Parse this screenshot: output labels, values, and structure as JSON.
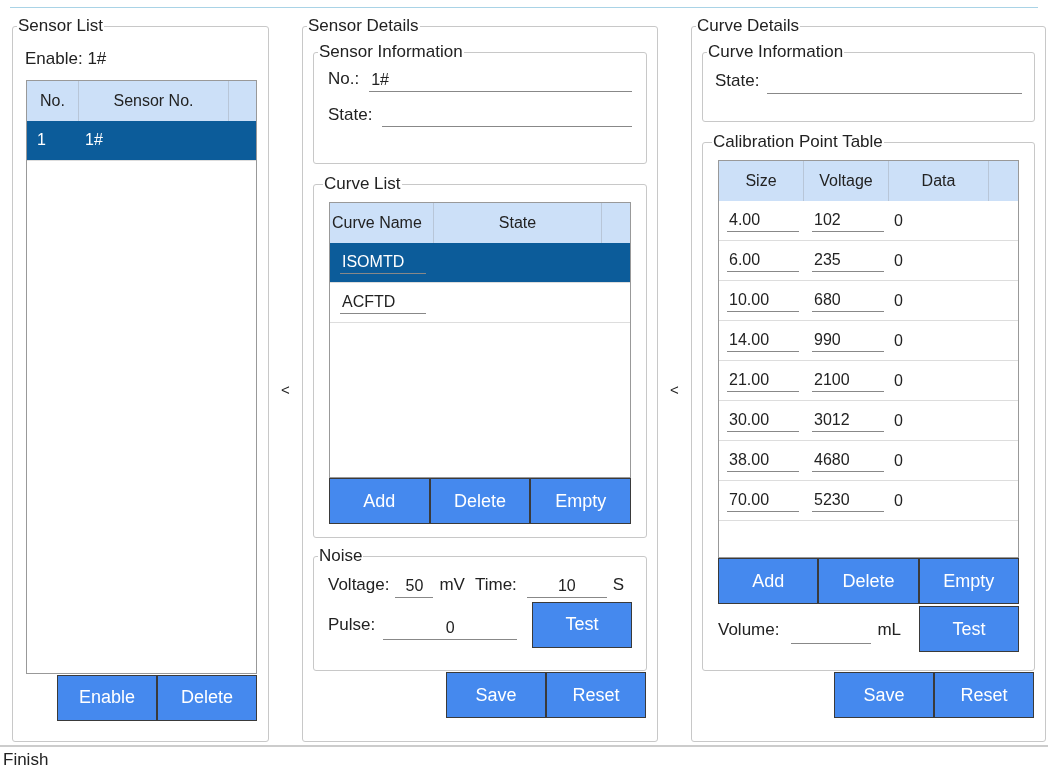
{
  "sensor_list": {
    "title": "Sensor List",
    "enable_label": "Enable: 1#",
    "columns": [
      "No.",
      "Sensor No."
    ],
    "rows": [
      {
        "cells": [
          "1",
          "1#"
        ],
        "selected": true
      }
    ],
    "buttons": [
      "Enable",
      "Delete"
    ]
  },
  "collapse_left": "<",
  "sensor_details": {
    "title": "Sensor Details",
    "sensor_information": {
      "title": "Sensor Information",
      "fields": [
        {
          "label": "No.:",
          "value": "1#"
        },
        {
          "label": "State:"
        }
      ]
    },
    "curve_list": {
      "title": "Curve List",
      "columns": [
        "Curve Name",
        "State"
      ],
      "rows": [
        {
          "name": "ISOMTD",
          "selected": true
        },
        {
          "name": "ACFTD",
          "selected": false
        }
      ],
      "buttons": [
        "Add",
        "Delete",
        "Empty"
      ]
    },
    "noise": {
      "title": "Noise",
      "voltage_label": "Voltage:",
      "voltage": "50",
      "voltage_unit": "mV",
      "time_label": "Time:",
      "time": "10",
      "time_unit": "S",
      "pulse_label": "Pulse:",
      "pulse": "0",
      "test_button": "Test"
    },
    "buttons": [
      "Save",
      "Reset"
    ]
  },
  "collapse_right": "<",
  "curve_details": {
    "title": "Curve Details",
    "curve_information": {
      "title": "Curve Information",
      "state_label": "State:"
    },
    "calibration_point_table": {
      "title": "Calibration Point Table",
      "columns": [
        "Size",
        "Voltage",
        "Data"
      ],
      "rows": [
        {
          "size": "4.00",
          "voltage": "102",
          "data": "0"
        },
        {
          "size": "6.00",
          "voltage": "235",
          "data": "0"
        },
        {
          "size": "10.00",
          "voltage": "680",
          "data": "0"
        },
        {
          "size": "14.00",
          "voltage": "990",
          "data": "0"
        },
        {
          "size": "21.00",
          "voltage": "2100",
          "data": "0"
        },
        {
          "size": "30.00",
          "voltage": "3012",
          "data": "0"
        },
        {
          "size": "38.00",
          "voltage": "4680",
          "data": "0"
        },
        {
          "size": "70.00",
          "voltage": "5230",
          "data": "0"
        }
      ],
      "buttons": [
        "Add",
        "Delete",
        "Empty"
      ],
      "volume_label": "Volume:",
      "volume_unit": "mL",
      "test_button": "Test"
    },
    "buttons": [
      "Save",
      "Reset"
    ]
  },
  "status_bar": {
    "text": "Finish"
  }
}
